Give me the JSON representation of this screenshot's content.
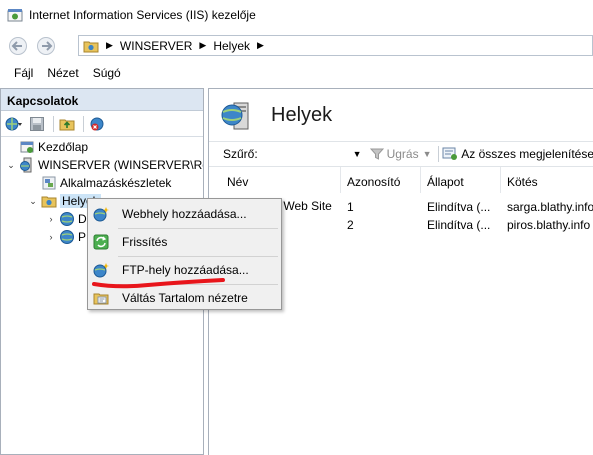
{
  "window": {
    "title": "Internet Information Services (IIS) kezelője"
  },
  "address": {
    "crumbs": [
      "WINSERVER",
      "Helyek"
    ]
  },
  "menu": {
    "items": [
      "Fájl",
      "Nézet",
      "Súgó"
    ]
  },
  "connections": {
    "header": "Kapcsolatok",
    "tree": {
      "start_page": "Kezdőlap",
      "server": "WINSERVER (WINSERVER\\Ren",
      "app_pools": "Alkalmazáskészletek",
      "sites": "Helyek",
      "site_1_label": "D",
      "site_2_label": "P"
    }
  },
  "main": {
    "heading": "Helyek",
    "filter": {
      "label": "Szűrő:",
      "go_label": "Ugrás",
      "show_all_label": "Az összes megjelenítése"
    },
    "columns": [
      "Név",
      "Azonosító",
      "Állapot",
      "Kötés"
    ],
    "rows": [
      {
        "name": "Default Web Site",
        "id": "1",
        "status": "Elindítva (...",
        "binding": "sarga.blathy.info"
      },
      {
        "name": "",
        "id": "2",
        "status": "Elindítva (...",
        "binding": "piros.blathy.info"
      }
    ]
  },
  "context_menu": {
    "items": [
      "Webhely hozzáadása...",
      "Frissítés",
      "FTP-hely hozzáadása...",
      "Váltás Tartalom nézetre"
    ]
  },
  "colors": {
    "panel_header": "#dce6f2",
    "highlight_mark": "#e8151b"
  }
}
